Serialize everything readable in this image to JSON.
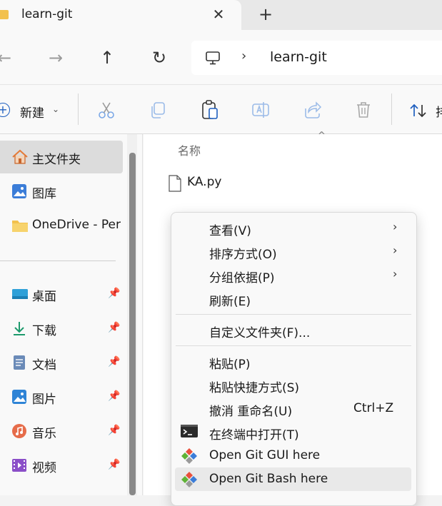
{
  "tab": {
    "title": "learn-git",
    "close_label": "✕",
    "new_label": "+"
  },
  "nav_buttons": {
    "back": "←",
    "forward": "→",
    "up": "↑",
    "refresh": "↻"
  },
  "address": {
    "separator": "›",
    "path": "learn-git"
  },
  "command_bar": {
    "new_label": "新建",
    "new_caret": "⌄",
    "sort_label": "排"
  },
  "sidebar": {
    "items": [
      {
        "label": "主文件夹",
        "icon": "home-icon"
      },
      {
        "label": "图库",
        "icon": "gallery-icon"
      },
      {
        "label": "OneDrive - Per",
        "icon": "folder-icon"
      },
      {
        "label": "桌面",
        "icon": "desktop-icon",
        "pinned": true
      },
      {
        "label": "下载",
        "icon": "download-icon",
        "pinned": true
      },
      {
        "label": "文档",
        "icon": "document-icon",
        "pinned": true
      },
      {
        "label": "图片",
        "icon": "pictures-icon",
        "pinned": true
      },
      {
        "label": "音乐",
        "icon": "music-icon",
        "pinned": true
      },
      {
        "label": "视频",
        "icon": "video-icon",
        "pinned": true
      }
    ],
    "pin_glyph": "📌"
  },
  "file_list": {
    "column_name": "名称",
    "sort_caret": "^",
    "files": [
      {
        "name": "KA.py",
        "icon": "python-file-icon"
      }
    ]
  },
  "context_menu": {
    "items": [
      {
        "label": "查看(V)",
        "submenu": "›"
      },
      {
        "label": "排序方式(O)",
        "submenu": "›"
      },
      {
        "label": "分组依据(P)",
        "submenu": "›"
      },
      {
        "label": "刷新(E)"
      },
      {
        "label": "自定义文件夹(F)..."
      },
      {
        "label": "粘贴(P)"
      },
      {
        "label": "粘贴快捷方式(S)"
      },
      {
        "label": "撤消 重命名(U)",
        "accelerator": "Ctrl+Z"
      },
      {
        "label": "在终端中打开(T)",
        "icon": "terminal-icon"
      },
      {
        "label": "Open Git GUI here",
        "icon": "git-gui-icon"
      },
      {
        "label": "Open Git Bash here",
        "icon": "git-bash-icon",
        "highlighted": true
      }
    ]
  },
  "colors": {
    "accent": "#1f5fbf",
    "folder": "#f2c14e",
    "selection": "#dcdcdc",
    "menu_hover": "#e9e9e9",
    "git_red": "#e9503c",
    "git_green": "#5fb336",
    "git_blue": "#3b7dd8"
  }
}
